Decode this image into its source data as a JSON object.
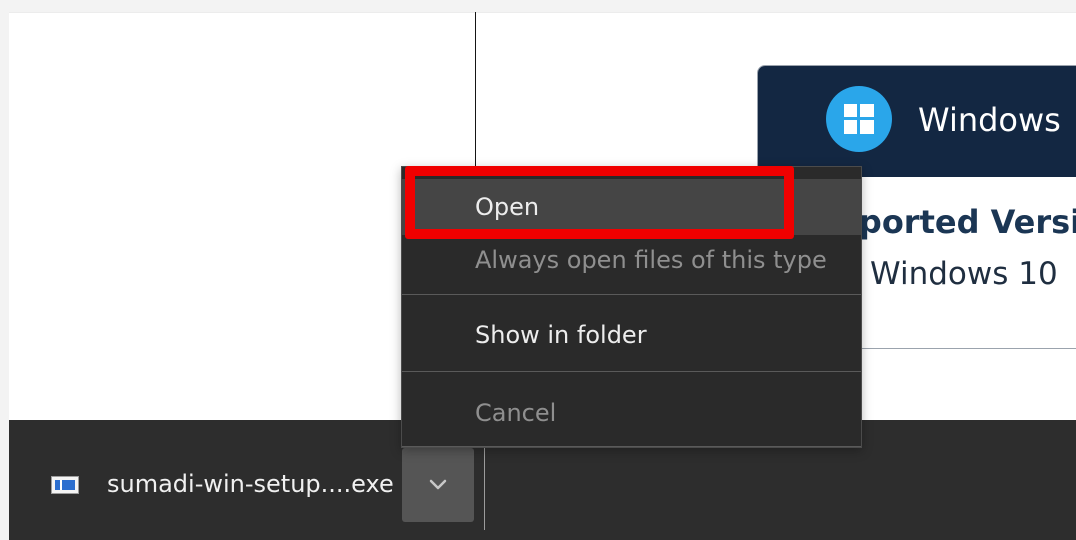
{
  "page": {
    "platform_card": {
      "title": "Windows",
      "supported_title": "pported Version",
      "supported_value": "Windows 10",
      "logo_icon": "windows-logo-icon",
      "header_color": "#132742",
      "logo_color": "#2aa6ea"
    }
  },
  "download_bar": {
    "file_name": "sumadi-win-setup....exe",
    "file_icon": "executable-file-icon",
    "menu_toggle_icon": "chevron-down-icon",
    "bar_color": "#2d2d2d"
  },
  "context_menu": {
    "items": [
      {
        "label": "Open",
        "state": "hovered"
      },
      {
        "label": "Always open files of this type",
        "state": "disabled"
      },
      {
        "label": "Show in folder",
        "state": "enabled"
      },
      {
        "label": "Cancel",
        "state": "disabled"
      }
    ],
    "menu_color": "#2a2a2a",
    "highlight_color": "#f00000"
  }
}
